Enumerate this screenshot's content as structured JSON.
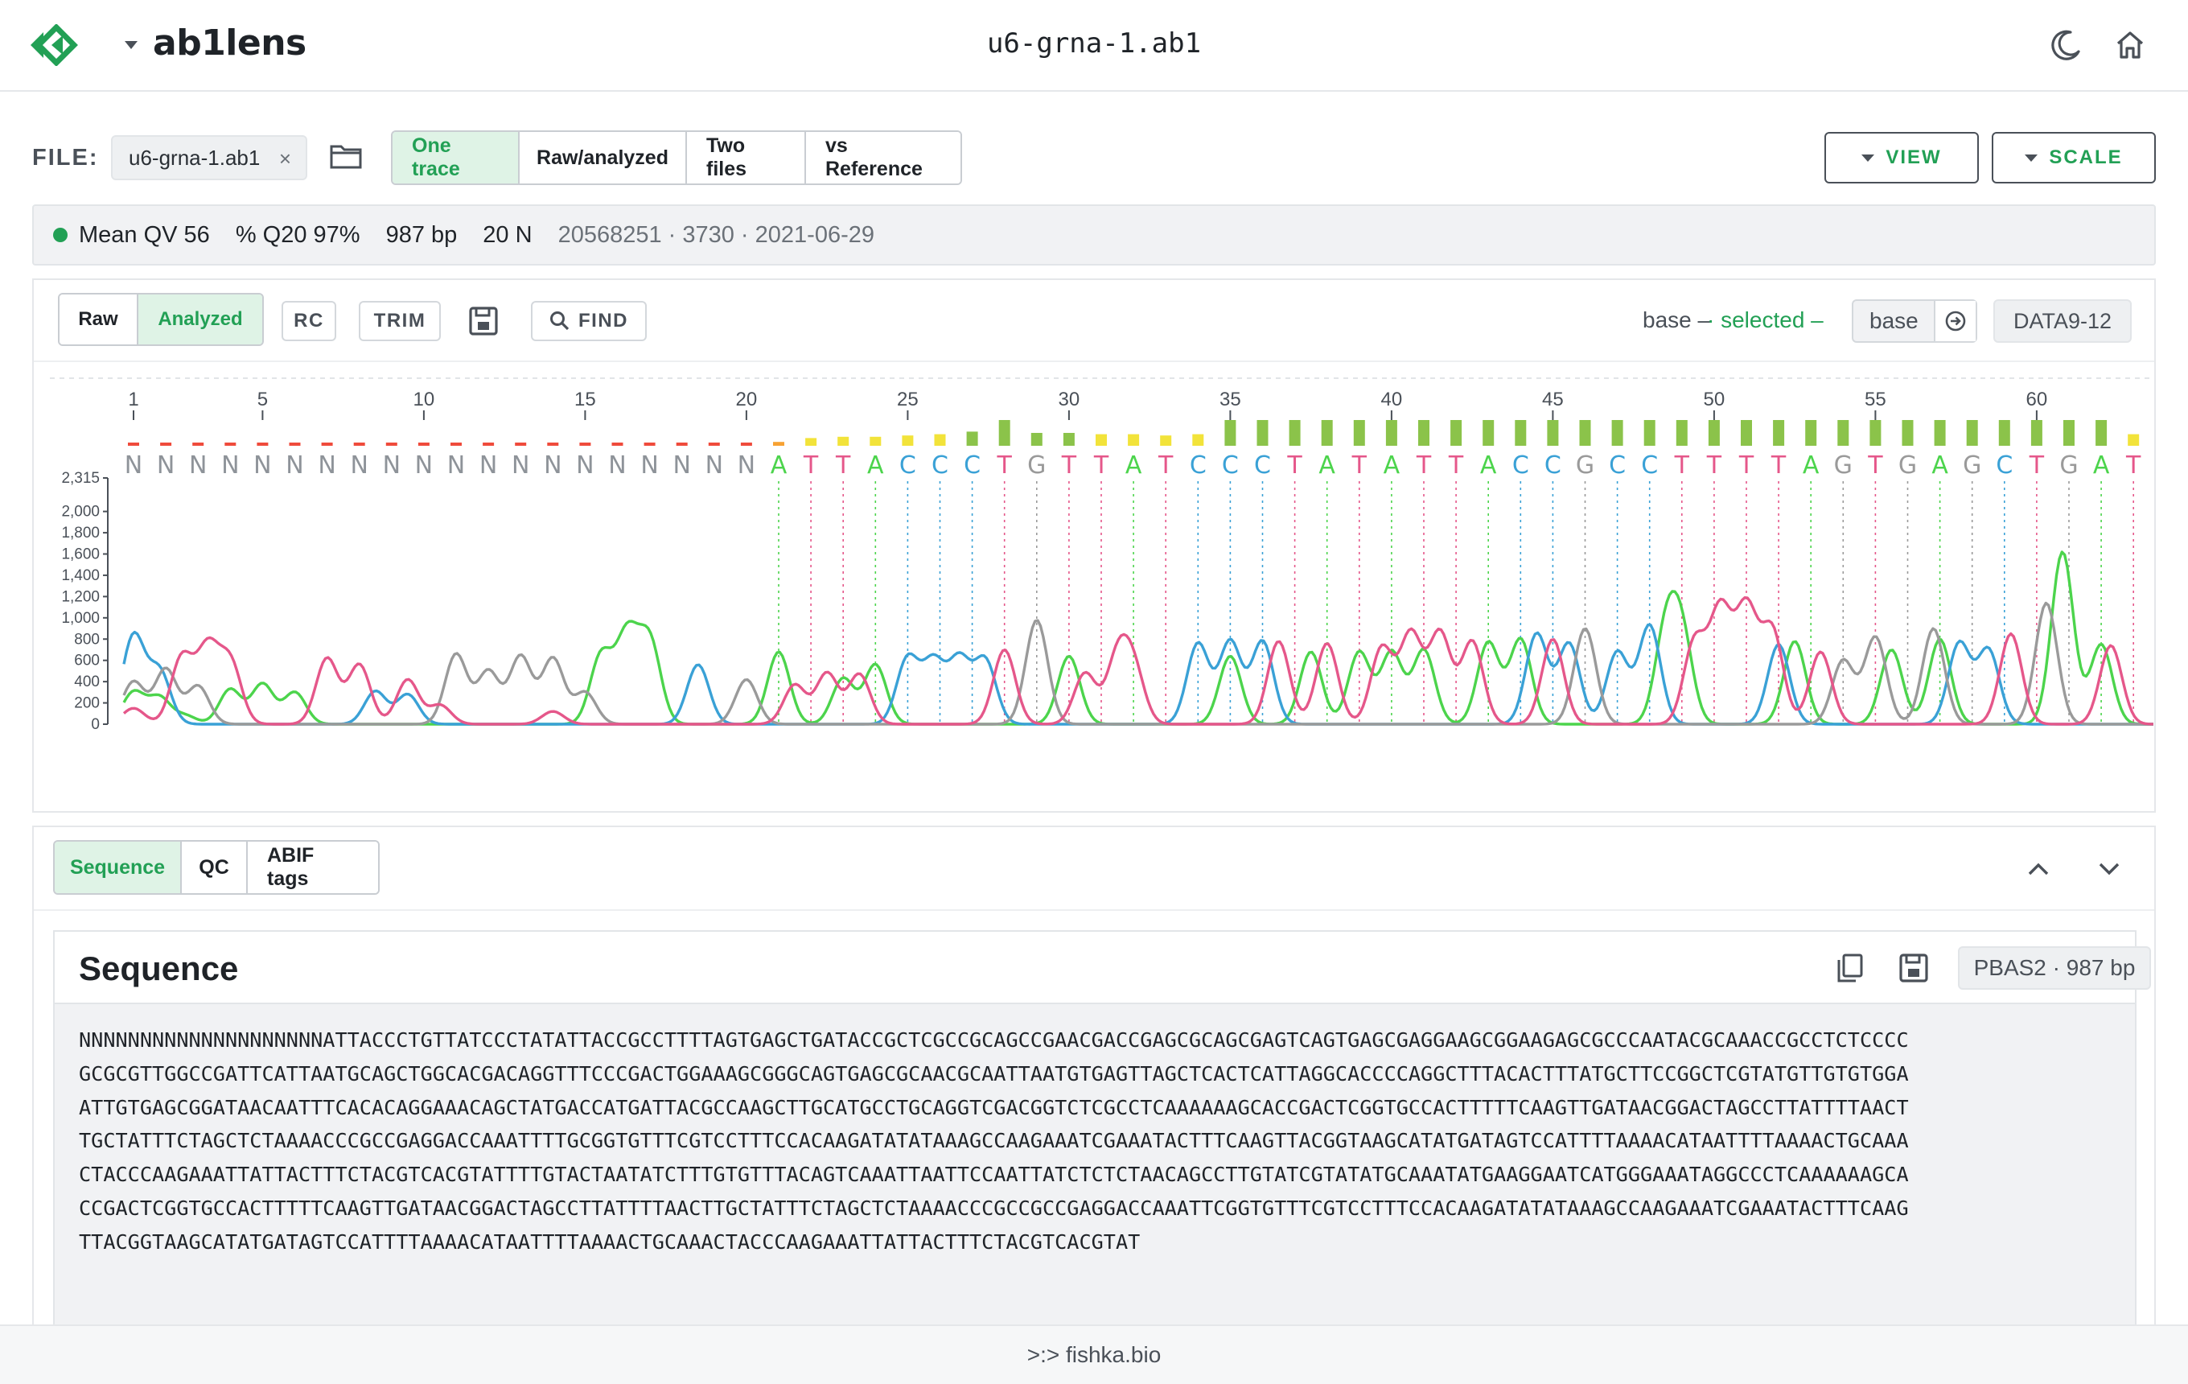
{
  "header": {
    "app_name": "ab1lens",
    "file_title": "u6-grna-1.ab1",
    "icons": [
      "logo-icon",
      "caret-down-icon",
      "moon-icon",
      "home-icon"
    ]
  },
  "file_row": {
    "label": "FILE:",
    "chip": "u6-grna-1.ab1",
    "close_glyph": "×",
    "modes": [
      {
        "label": "One trace",
        "active": true
      },
      {
        "label": "Raw/analyzed",
        "active": false
      },
      {
        "label": "Two files",
        "active": false
      },
      {
        "label": "vs Reference",
        "active": false
      }
    ],
    "view_label": "VIEW",
    "scale_label": "SCALE"
  },
  "stats": {
    "mean_qv": "Mean QV 56",
    "q20": "% Q20 97%",
    "length": "987 bp",
    "n_count": "20 N",
    "meta": "20568251 · 3730 · 2021-06-29"
  },
  "trace_toolbar": {
    "raw": "Raw",
    "analyzed": "Analyzed",
    "rc": "RC",
    "trim": "TRIM",
    "find": "FIND",
    "legend_base": "base –",
    "legend_selected": "· selected –",
    "base_placeholder": "base",
    "data_chip": "DATA9-12"
  },
  "colors": {
    "A": "#4cd44c",
    "C": "#3aa1d6",
    "G": "#9a9a9a",
    "T": "#e5578a",
    "accent": "#22a055",
    "qv_high": "#8bc34a",
    "qv_mid": "#f2e33a",
    "qv_low": "#ef4b3c",
    "qv_orange": "#f7a233"
  },
  "chart_data": {
    "type": "line",
    "title": "",
    "xlabel": "",
    "ylabel": "",
    "ylim": [
      0,
      2315
    ],
    "y_ticks": [
      0,
      200,
      400,
      600,
      800,
      1000,
      1200,
      1400,
      1600,
      1800,
      2000,
      2315
    ],
    "position_ticks": [
      1,
      5,
      10,
      15,
      20,
      25,
      30,
      35,
      40,
      45,
      50,
      55,
      60
    ],
    "bases": "NNNNNNNNNNNNNNNNNNNNATTACCCTGTTATCCCTATATTACCGCCTTTTAGTGAGCTGATA",
    "quality": [
      2,
      2,
      3,
      2,
      2,
      2,
      3,
      2,
      2,
      2,
      2,
      2,
      2,
      2,
      2,
      3,
      2,
      2,
      2,
      2,
      6,
      12,
      14,
      14,
      16,
      18,
      22,
      40,
      20,
      20,
      18,
      18,
      16,
      18,
      40,
      40,
      40,
      40,
      40,
      40,
      40,
      40,
      40,
      40,
      40,
      40,
      40,
      40,
      40,
      40,
      40,
      40,
      40,
      40,
      40,
      40,
      40,
      40,
      40,
      40,
      40,
      40,
      18,
      18,
      40
    ],
    "series": [
      {
        "name": "A",
        "peaks": [
          [
            0.0,
            300
          ],
          [
            0.8,
            250
          ],
          [
            1.6,
            80
          ],
          [
            3.0,
            330
          ],
          [
            4.0,
            380
          ],
          [
            5.0,
            300
          ],
          [
            14.5,
            650
          ],
          [
            15.3,
            820
          ],
          [
            16.0,
            780
          ],
          [
            20.0,
            680
          ],
          [
            22.0,
            430
          ],
          [
            23.0,
            560
          ],
          [
            29.0,
            640
          ],
          [
            34.0,
            640
          ],
          [
            36.5,
            680
          ],
          [
            38.0,
            680
          ],
          [
            39.0,
            680
          ],
          [
            40.0,
            700
          ],
          [
            42.0,
            770
          ],
          [
            43.0,
            800
          ],
          [
            47.5,
            840
          ],
          [
            48.0,
            800
          ],
          [
            51.5,
            780
          ],
          [
            54.5,
            700
          ],
          [
            56.0,
            800
          ],
          [
            59.8,
            1620
          ],
          [
            61.0,
            750
          ]
        ]
      },
      {
        "name": "C",
        "peaks": [
          [
            0.0,
            830
          ],
          [
            0.8,
            500
          ],
          [
            7.5,
            310
          ],
          [
            8.5,
            280
          ],
          [
            17.5,
            560
          ],
          [
            24.0,
            620
          ],
          [
            24.8,
            580
          ],
          [
            25.6,
            600
          ],
          [
            26.4,
            600
          ],
          [
            33.0,
            760
          ],
          [
            34.0,
            780
          ],
          [
            35.0,
            780
          ],
          [
            43.5,
            850
          ],
          [
            44.5,
            760
          ],
          [
            46.0,
            680
          ],
          [
            47.0,
            930
          ],
          [
            51.0,
            750
          ],
          [
            56.6,
            760
          ],
          [
            57.5,
            700
          ]
        ]
      },
      {
        "name": "G",
        "peaks": [
          [
            0.0,
            400
          ],
          [
            1.0,
            520
          ],
          [
            2.0,
            360
          ],
          [
            10.0,
            660
          ],
          [
            11.0,
            500
          ],
          [
            12.0,
            640
          ],
          [
            13.0,
            620
          ],
          [
            14.0,
            300
          ],
          [
            19.0,
            420
          ],
          [
            28.0,
            980
          ],
          [
            45.0,
            900
          ],
          [
            53.0,
            600
          ],
          [
            54.0,
            820
          ],
          [
            55.8,
            900
          ],
          [
            59.3,
            1140
          ]
        ]
      },
      {
        "name": "T",
        "peaks": [
          [
            0.0,
            150
          ],
          [
            1.5,
            630
          ],
          [
            2.3,
            700
          ],
          [
            3.0,
            580
          ],
          [
            6.0,
            620
          ],
          [
            7.0,
            560
          ],
          [
            8.5,
            420
          ],
          [
            9.5,
            180
          ],
          [
            13.0,
            120
          ],
          [
            20.5,
            370
          ],
          [
            21.5,
            480
          ],
          [
            22.5,
            470
          ],
          [
            27.0,
            700
          ],
          [
            29.5,
            480
          ],
          [
            30.5,
            600
          ],
          [
            31.0,
            500
          ],
          [
            35.5,
            780
          ],
          [
            37.0,
            760
          ],
          [
            38.7,
            720
          ],
          [
            39.6,
            850
          ],
          [
            40.5,
            860
          ],
          [
            41.5,
            780
          ],
          [
            44.0,
            800
          ],
          [
            48.4,
            780
          ],
          [
            49.2,
            1060
          ],
          [
            50.0,
            1070
          ],
          [
            50.8,
            880
          ],
          [
            52.3,
            680
          ],
          [
            58.2,
            850
          ],
          [
            61.3,
            740
          ]
        ]
      }
    ]
  },
  "bottom_tabs": [
    {
      "label": "Sequence",
      "active": true
    },
    {
      "label": "QC",
      "active": false
    },
    {
      "label": "ABIF tags",
      "active": false
    }
  ],
  "sequence": {
    "title": "Sequence",
    "badge": "PBAS2 · 987 bp",
    "lines": [
      "NNNNNNNNNNNNNNNNNNNNATTACCCTGTTATCCCTATATTACCGCCTTTTAGTGAGCTGATACCGCTCGCCGCAGCCGAACGACCGAGCGCAGCGAGTCAGTGAGCGAGGAAGCGGAAGAGCGCCCAATACGCAAACCGCCTCTCCCC",
      "GCGCGTTGGCCGATTCATTAATGCAGCTGGCACGACAGGTTTCCCGACTGGAAAGCGGGCAGTGAGCGCAACGCAATTAATGTGAGTTAGCTCACTCATTAGGCACCCCAGGCTTTACACTTTATGCTTCCGGCTCGTATGTTGTGTGGA",
      "ATTGTGAGCGGATAACAATTTCACACAGGAAACAGCTATGACCATGATTACGCCAAGCTTGCATGCCTGCAGGTCGACGGTCTCGCCTCAAAAAAGCACCGACTCGGTGCCACTTTTTCAAGTTGATAACGGACTAGCCTTATTTTAACT",
      "TGCTATTTCTAGCTCTAAAACCCGCCGAGGACCAAATTTTGCGGTGTTTCGTCCTTTCCACAAGATATATAAAGCCAAGAAATCGAAATACTTTCAAGTTACGGTAAGCATATGATAGTCCATTTTAAAACATAATTTTAAAACTGCAAA",
      "CTACCCAAGAAATTATTACTTTCTACGTCACGTATTTTGTACTAATATCTTTGTGTTTACAGTCAAATTAATTCCAATTATCTCTCTAACAGCCTTGTATCGTATATGCAAATATGAAGGAATCATGGGAAATAGGCCCTCAAAAAAGCA",
      "CCGACTCGGTGCCACTTTTTCAAGTTGATAACGGACTAGCCTTATTTTAACTTGCTATTTCTAGCTCTAAAACCCGCCGCCGAGGACCAAATTCGGTGTTTCGTCCTTTCCACAAGATATATAAAGCCAAGAAATCGAAATACTTTCAAG",
      "TTACGGTAAGCATATGATAGTCCATTTTAAAACATAATTTTAAAACTGCAAACTACCCAAGAAATTATTACTTTCTACGTCACGTAT"
    ]
  },
  "footer": {
    "text": ">:> fishka.bio"
  }
}
